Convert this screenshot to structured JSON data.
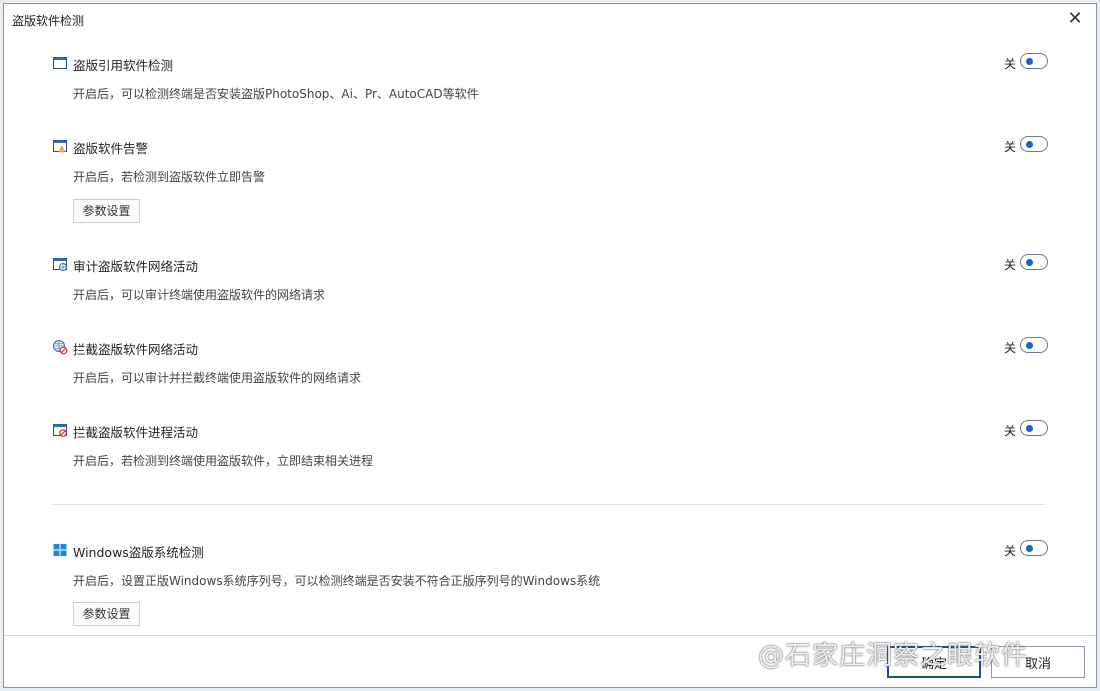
{
  "dialog": {
    "title": "盗版软件检测",
    "close_glyph": "✕"
  },
  "toggle_off_label": "关",
  "sections": [
    {
      "icon": "window-icon",
      "title": "盗版引用软件检测",
      "desc": "开启后，可以检测终端是否安装盗版PhotoShop、Ai、Pr、AutoCAD等软件",
      "state": "关"
    },
    {
      "icon": "window-alert-icon",
      "title": "盗版软件告警",
      "desc": "开启后，若检测到盗版软件立即告警",
      "state": "关",
      "button": "参数设置"
    },
    {
      "icon": "window-network-icon",
      "title": "审计盗版软件网络活动",
      "desc": "开启后，可以审计终端使用盗版软件的网络请求",
      "state": "关"
    },
    {
      "icon": "globe-block-icon",
      "title": "拦截盗版软件网络活动",
      "desc": "开启后，可以审计并拦截终端使用盗版软件的网络请求",
      "state": "关"
    },
    {
      "icon": "window-block-icon",
      "title": "拦截盗版软件进程活动",
      "desc": "开启后，若检测到终端使用盗版软件，立即结束相关进程",
      "state": "关"
    },
    {
      "icon": "windows-logo-icon",
      "title": "Windows盗版系统检测",
      "desc": "开启后，设置正版Windows系统序列号，可以检测终端是否安装不符合正版序列号的Windows系统",
      "state": "关",
      "button": "参数设置"
    }
  ],
  "footer": {
    "ok_label": "确定",
    "cancel_label": "取消"
  },
  "watermark": "@石家庄洞察之眼软件",
  "colors": {
    "accent": "#1a66c2",
    "border": "#8a96a6"
  }
}
